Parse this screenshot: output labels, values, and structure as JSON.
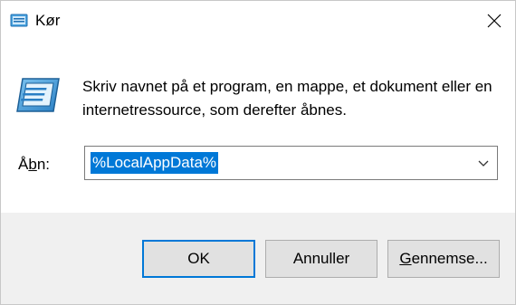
{
  "window": {
    "title": "Kør",
    "title_icon": "run-dialog-icon",
    "close_icon": "close-icon"
  },
  "content": {
    "app_icon": "run-program-icon",
    "description": "Skriv navnet på et program, en mappe, et dokument eller en internetressource, som derefter åbnes.",
    "open_label_prefix": "Å",
    "open_label_accel": "b",
    "open_label_suffix": "n:",
    "open_value": "%LocalAppData%",
    "dropdown_icon": "chevron-down-icon"
  },
  "buttons": {
    "ok_label": "OK",
    "cancel_label": "Annuller",
    "browse_accel": "G",
    "browse_rest": "ennemse..."
  },
  "colors": {
    "accent": "#0078d7",
    "footer_bg": "#f0f0f0",
    "button_bg": "#e1e1e1"
  }
}
